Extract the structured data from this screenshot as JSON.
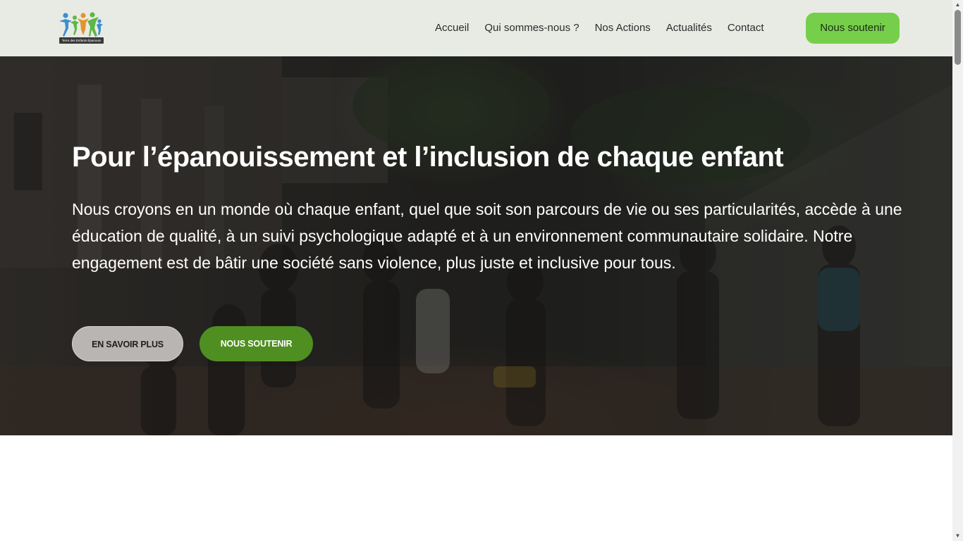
{
  "brand": {
    "logo_text": "Terre des Enfants Épanouis",
    "colors": {
      "blue": "#3b8fd0",
      "green": "#5fb646",
      "orange": "#e3942c"
    }
  },
  "nav": {
    "items": [
      {
        "label": "Accueil"
      },
      {
        "label": "Qui sommes-nous ?"
      },
      {
        "label": "Nos Actions"
      },
      {
        "label": "Actualités"
      },
      {
        "label": "Contact"
      }
    ],
    "cta_label": "Nous soutenir",
    "cta_color": "#76cf4b"
  },
  "hero": {
    "title": "Pour l’épanouissement et l’inclusion de chaque enfant",
    "text": "Nous croyons en un monde où chaque enfant, quel que soit son parcours de vie ou ses particularités, accède à une éducation de qualité, à un suivi psychologique adapté et à un environnement communautaire solidaire. Notre engagement est de bâtir une société sans violence, plus juste et inclusive pour tous.",
    "buttons": {
      "learn_more": "EN SAVOIR PLUS",
      "support": "NOUS SOUTENIR"
    },
    "support_color": "#4f8f22"
  },
  "scrollbar": {
    "up_icon": "arrow-up-icon",
    "down_icon": "arrow-down-icon"
  }
}
